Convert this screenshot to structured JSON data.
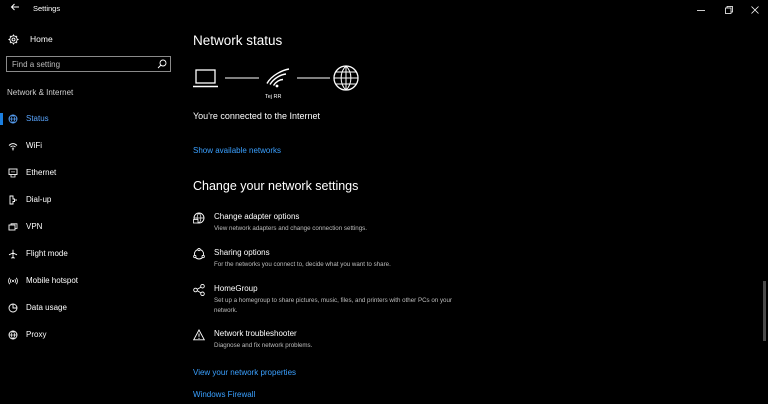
{
  "window": {
    "title": "Settings"
  },
  "sidebar": {
    "home_label": "Home",
    "search_placeholder": "Find a setting",
    "section_label": "Network & Internet",
    "items": [
      {
        "label": "Status",
        "icon": "status-globe-icon",
        "active": true
      },
      {
        "label": "WiFi",
        "icon": "wifi-icon"
      },
      {
        "label": "Ethernet",
        "icon": "ethernet-icon"
      },
      {
        "label": "Dial-up",
        "icon": "dialup-icon"
      },
      {
        "label": "VPN",
        "icon": "vpn-icon"
      },
      {
        "label": "Flight mode",
        "icon": "airplane-icon"
      },
      {
        "label": "Mobile hotspot",
        "icon": "hotspot-icon"
      },
      {
        "label": "Data usage",
        "icon": "data-usage-icon"
      },
      {
        "label": "Proxy",
        "icon": "globe-icon"
      }
    ]
  },
  "main": {
    "title": "Network status",
    "network_name": "Tej RR",
    "connection_status": "You're connected to the Internet",
    "show_networks_link": "Show available networks",
    "change_title": "Change your network settings",
    "options": [
      {
        "title": "Change adapter options",
        "desc": "View network adapters and change connection settings.",
        "icon": "adapter-globe-icon"
      },
      {
        "title": "Sharing options",
        "desc": "For the networks you connect to, decide what you want to share.",
        "icon": "sharing-icon"
      },
      {
        "title": "HomeGroup",
        "desc": "Set up a homegroup to share pictures, music, files, and printers with other PCs on your network.",
        "icon": "homegroup-icon"
      },
      {
        "title": "Network troubleshooter",
        "desc": "Diagnose and fix network problems.",
        "icon": "warning-icon"
      }
    ],
    "view_properties_link": "View your network properties",
    "firewall_link": "Windows Firewall"
  },
  "colors": {
    "accent": "#1b7fe0",
    "link": "#3aa0ff",
    "background": "#000000"
  }
}
